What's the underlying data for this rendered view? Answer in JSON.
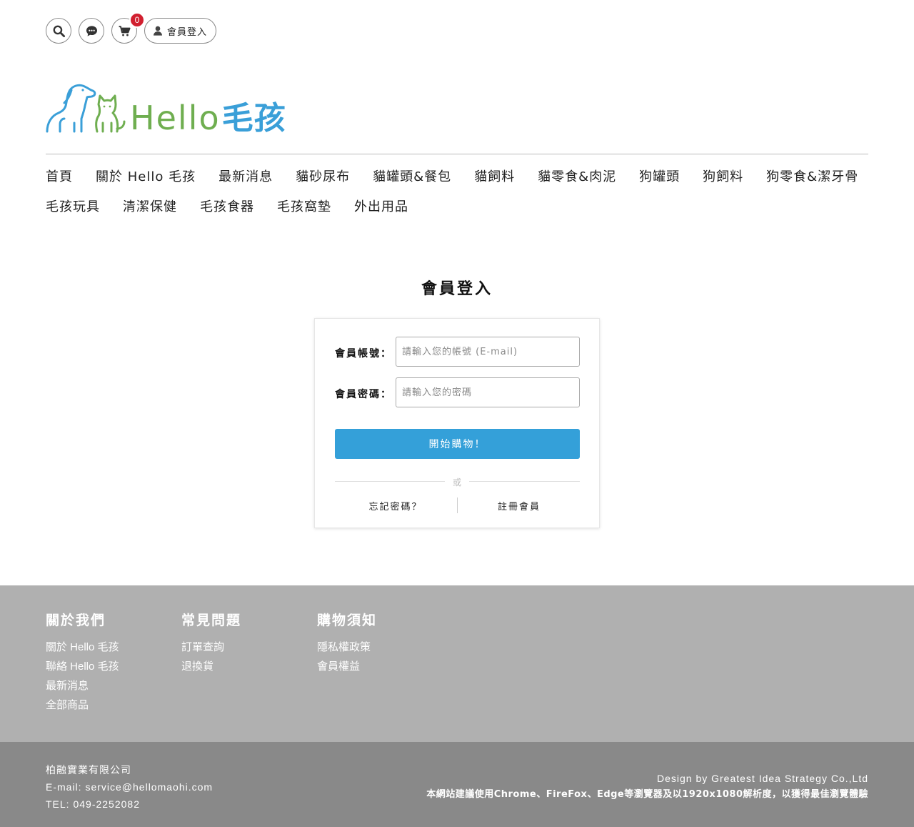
{
  "topbar": {
    "search_icon": "search-icon",
    "chat_icon": "chat-icon",
    "cart_icon": "cart-icon",
    "cart_count": "0",
    "login_label": "會員登入",
    "badge_color": "#d11f2f"
  },
  "logo": {
    "hello": "Hello",
    "maohai": "毛孩",
    "hello_color": "#6fae50",
    "brand_color": "#3a9fd8"
  },
  "nav": {
    "items": [
      "首頁",
      "關於 Hello 毛孩",
      "最新消息",
      "貓砂尿布",
      "貓罐頭&餐包",
      "貓飼料",
      "貓零食&肉泥",
      "狗罐頭",
      "狗飼料",
      "狗零食&潔牙骨",
      "毛孩玩具",
      "清潔保健",
      "毛孩食器",
      "毛孩窩墊",
      "外出用品"
    ]
  },
  "login": {
    "title": "會員登入",
    "account_label": "會員帳號：",
    "account_placeholder": "請輸入您的帳號 (E-mail)",
    "password_label": "會員密碼：",
    "password_placeholder": "請輸入您的密碼",
    "submit_label": "開始購物！",
    "or_text": "或",
    "forgot_label": "忘記密碼？",
    "register_label": "註冊會員",
    "button_color": "#34a0d9"
  },
  "footer": {
    "columns": [
      {
        "title": "關於我們",
        "links": [
          "關於 Hello 毛孩",
          "聯絡 Hello 毛孩",
          "最新消息",
          "全部商品"
        ]
      },
      {
        "title": "常見問題",
        "links": [
          "訂單查詢",
          "退換貨"
        ]
      },
      {
        "title": "購物須知",
        "links": [
          "隱私權政策",
          "會員權益"
        ]
      }
    ],
    "company": "柏融實業有限公司",
    "email": "E-mail: service@hellomaohi.com",
    "tel": "TEL: 049-2252082",
    "design": "Design by Greatest Idea Strategy Co.,Ltd",
    "browser_note": "本網站建議使用Chrome、FireFox、Edge等瀏覽器及以1920x1080解析度，以獲得最佳瀏覽體驗"
  }
}
